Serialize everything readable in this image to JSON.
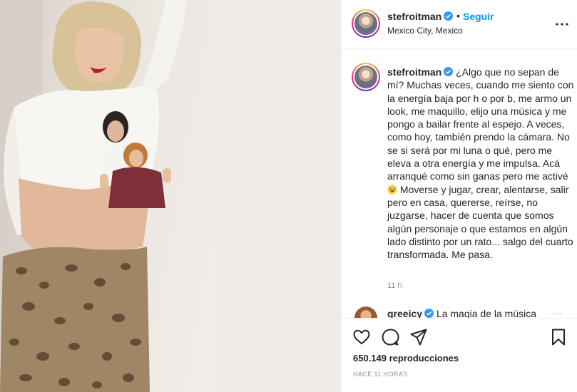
{
  "post": {
    "media_alt": "",
    "header": {
      "username": "stefroitman",
      "separator": "•",
      "follow_label": "Seguir",
      "location": "Mexico City, Mexico",
      "more_icon": "ellipsis-icon"
    },
    "caption": {
      "username": "stefroitman",
      "text": "¿Algo que no sepan de mí? Muchas veces, cuando me siento con la energía baja por h o por b, me armo un look, me maquillo, elijo una música y me pongo a bailar frente al espejo. A veces, como hoy, también prendo la cámara. No se si será por mi luna o qué, pero me eleva a otra energía y me impulsa. Acá arranqué como sin ganas pero me activé",
      "text_after_emoji": "Moverse y jugar, crear, alentarse, salir pero en casa, quererse, reírse, no juzgarse, hacer de cuenta que somos algún personaje o que estamos en algún lado distinto por un rato... salgo del cuarto transformada. Me pasa.",
      "time": "11 h"
    },
    "comment": {
      "username": "greeicy",
      "text": "La magia de la música",
      "more": "..."
    },
    "actions": {
      "like_icon": "heart-icon",
      "comment_icon": "comment-icon",
      "share_icon": "share-icon",
      "save_icon": "bookmark-icon"
    },
    "stats": {
      "views": "650.149 reproducciones",
      "posted": "HACE 11 HORAS"
    }
  }
}
